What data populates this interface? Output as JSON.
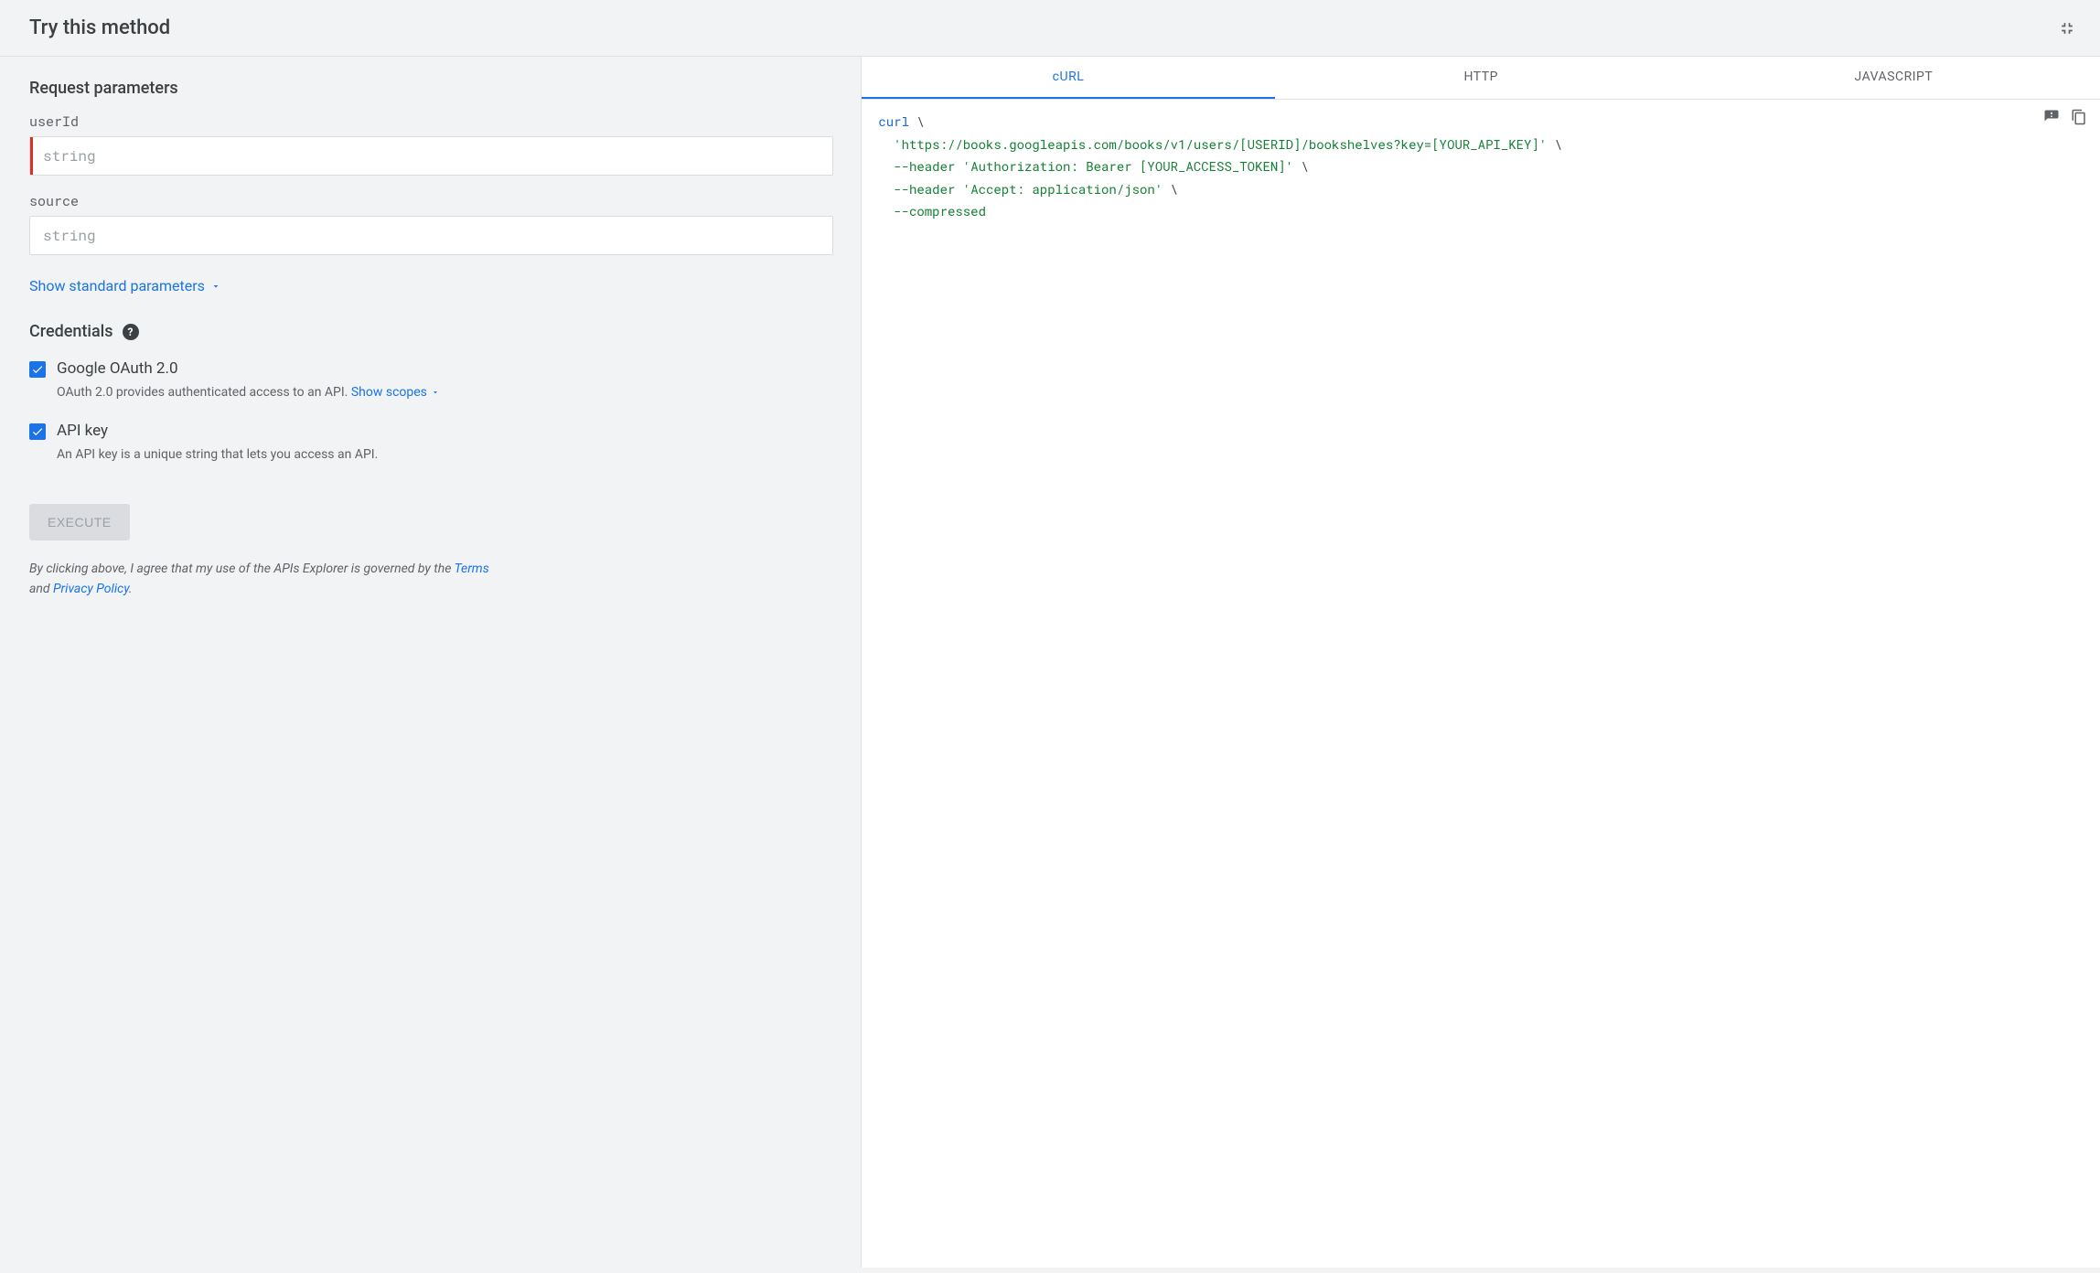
{
  "header": {
    "title": "Try this method"
  },
  "params": {
    "section_title": "Request parameters",
    "items": [
      {
        "name": "userId",
        "placeholder": "string",
        "required": true
      },
      {
        "name": "source",
        "placeholder": "string",
        "required": false
      }
    ],
    "show_standard": "Show standard parameters"
  },
  "credentials": {
    "title": "Credentials",
    "oauth": {
      "label": "Google OAuth 2.0",
      "desc_prefix": "OAuth 2.0 provides authenticated access to an API. ",
      "show_scopes": "Show scopes",
      "checked": true
    },
    "apikey": {
      "label": "API key",
      "desc": "An API key is a unique string that lets you access an API.",
      "checked": true
    }
  },
  "execute": {
    "label": "EXECUTE"
  },
  "disclaimer": {
    "prefix": "By clicking above, I agree that my use of the APIs Explorer is governed by the ",
    "terms": "Terms",
    "and": " and ",
    "privacy": "Privacy Policy",
    "suffix": "."
  },
  "tabs": {
    "curl": "cURL",
    "http": "HTTP",
    "js": "JAVASCRIPT",
    "active": "curl"
  },
  "code": {
    "l1_kw": "curl",
    "l1_cont": " \\",
    "l2_str": "'https://books.googleapis.com/books/v1/users/[USERID]/bookshelves?key=[YOUR_API_KEY]'",
    "l2_cont": " \\",
    "l3_flag": "--header",
    "l3_str": " 'Authorization: Bearer [YOUR_ACCESS_TOKEN]'",
    "l3_cont": " \\",
    "l4_flag": "--header",
    "l4_str": " 'Accept: application/json'",
    "l4_cont": " \\",
    "l5_flag": "--compressed"
  }
}
